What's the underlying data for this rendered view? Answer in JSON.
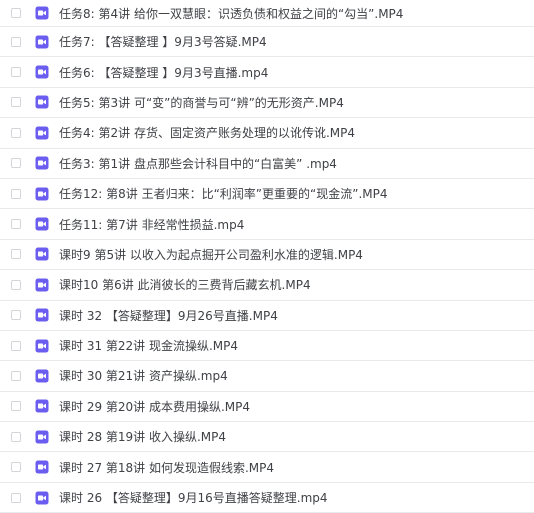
{
  "icon_color": "#6b5df0",
  "files": [
    {
      "name": "任务8:  第4讲 给你一双慧眼：识透负债和权益之间的“勾当”.MP4",
      "icon": "video-icon"
    },
    {
      "name": "任务7:  【答疑整理 】9月3号答疑.MP4",
      "icon": "video-icon"
    },
    {
      "name": "任务6:  【答疑整理 】9月3号直播.mp4",
      "icon": "video-icon"
    },
    {
      "name": "任务5:  第3讲 可“变”的商誉与可“辨”的无形资产.MP4",
      "icon": "video-icon"
    },
    {
      "name": "任务4:  第2讲 存货、固定资产账务处理的以讹传讹.MP4",
      "icon": "video-icon"
    },
    {
      "name": "任务3:  第1讲 盘点那些会计科目中的“白富美” .mp4",
      "icon": "video-icon"
    },
    {
      "name": "任务12:   第8讲 王者归来：比“利润率”更重要的“现金流”.MP4",
      "icon": "video-icon"
    },
    {
      "name": "任务11:   第7讲 非经常性损益.mp4",
      "icon": "video-icon"
    },
    {
      "name": "课时9 第5讲 以收入为起点掘开公司盈利水准的逻辑.MP4",
      "icon": "video-icon"
    },
    {
      "name": "课时10 第6讲 此消彼长的三费背后藏玄机.MP4",
      "icon": "video-icon"
    },
    {
      "name": "课时 32 【答疑整理】9月26号直播.MP4",
      "icon": "video-icon"
    },
    {
      "name": "课时 31 第22讲 现金流操纵.MP4",
      "icon": "video-icon"
    },
    {
      "name": "课时 30 第21讲 资产操纵.mp4",
      "icon": "video-icon"
    },
    {
      "name": "课时 29 第20讲 成本费用操纵.MP4",
      "icon": "video-icon"
    },
    {
      "name": "课时 28 第19讲 收入操纵.MP4",
      "icon": "video-icon"
    },
    {
      "name": "课时 27 第18讲 如何发现造假线索.MP4",
      "icon": "video-icon"
    },
    {
      "name": "课时 26 【答疑整理】9月16号直播答疑整理.mp4",
      "icon": "video-icon"
    }
  ]
}
